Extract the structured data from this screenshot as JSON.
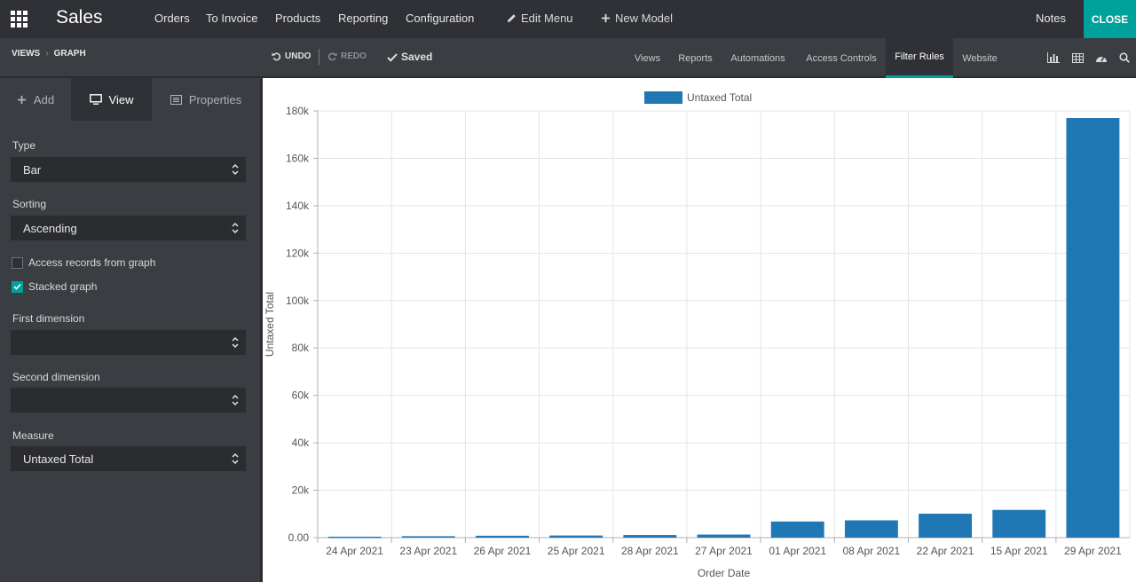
{
  "topbar": {
    "app_title": "Sales",
    "menu": [
      "Orders",
      "To Invoice",
      "Products",
      "Reporting",
      "Configuration"
    ],
    "edit_menu": "Edit Menu",
    "new_model": "New Model",
    "notes": "Notes",
    "close": "CLOSE"
  },
  "subbar": {
    "breadcrumb": [
      "VIEWS",
      "GRAPH"
    ],
    "undo": "UNDO",
    "redo": "REDO",
    "saved": "Saved",
    "tabs": [
      "Views",
      "Reports",
      "Automations",
      "Access Controls",
      "Filter Rules",
      "Website"
    ],
    "active_tab": "Filter Rules",
    "tool_icons": [
      "bar-chart-icon",
      "table-icon",
      "dashboard-icon",
      "search-icon"
    ]
  },
  "sidebar": {
    "tabs": [
      {
        "label": "Add",
        "icon": "plus-icon"
      },
      {
        "label": "View",
        "icon": "monitor-icon"
      },
      {
        "label": "Properties",
        "icon": "list-icon"
      }
    ],
    "active_tab": "View",
    "type_label": "Type",
    "type_value": "Bar",
    "sorting_label": "Sorting",
    "sorting_value": "Ascending",
    "access_records_label": "Access records from graph",
    "access_records_checked": false,
    "stacked_label": "Stacked graph",
    "stacked_checked": true,
    "first_dimension_label": "First dimension",
    "first_dimension_value": "",
    "second_dimension_label": "Second dimension",
    "second_dimension_value": "",
    "measure_label": "Measure",
    "measure_value": "Untaxed Total"
  },
  "colors": {
    "accent": "#00a09d",
    "bar": "#1f77b4"
  },
  "chart_data": {
    "type": "bar",
    "title": "",
    "xlabel": "Order Date",
    "ylabel": "Untaxed Total",
    "ylim": [
      0,
      180000
    ],
    "yticks": [
      "0.00",
      "20k",
      "40k",
      "60k",
      "80k",
      "100k",
      "120k",
      "140k",
      "160k",
      "180k"
    ],
    "legend_position": "top-center",
    "grid": true,
    "categories": [
      "24 Apr 2021",
      "23 Apr 2021",
      "26 Apr 2021",
      "25 Apr 2021",
      "28 Apr 2021",
      "27 Apr 2021",
      "01 Apr 2021",
      "08 Apr 2021",
      "22 Apr 2021",
      "15 Apr 2021",
      "29 Apr 2021"
    ],
    "series": [
      {
        "name": "Untaxed Total",
        "values": [
          400,
          600,
          800,
          900,
          1100,
          1300,
          6800,
          7300,
          10100,
          11700,
          177000
        ]
      }
    ]
  }
}
